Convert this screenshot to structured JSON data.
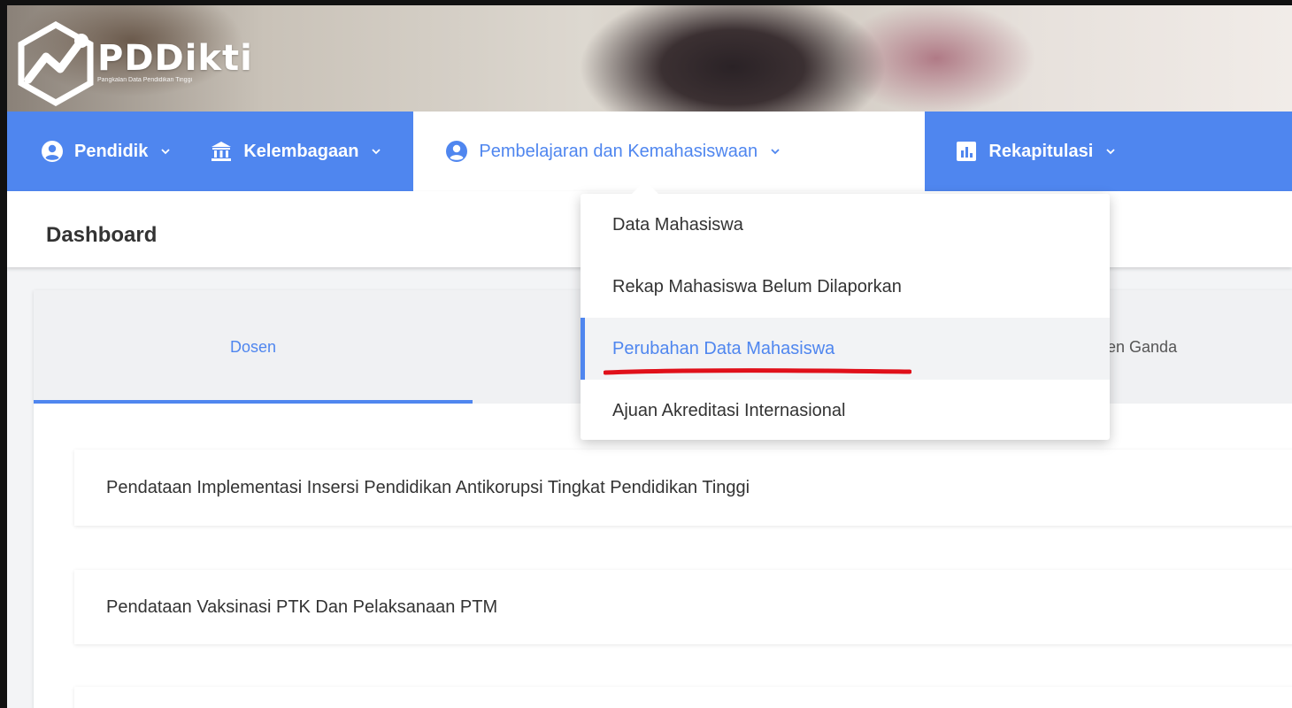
{
  "brand": {
    "name": "PDDikti",
    "tagline": "Pangkalan Data Pendidikan Tinggi"
  },
  "colors": {
    "primary": "#4f86ef",
    "annotation": "#e0101a"
  },
  "nav": {
    "items": [
      {
        "label": "Pendidik",
        "icon": "user-circle-icon"
      },
      {
        "label": "Kelembagaan",
        "icon": "institution-icon"
      },
      {
        "label": "Pembelajaran dan Kemahasiswaan",
        "icon": "user-circle-icon",
        "active": true
      },
      {
        "label": "Rekapitulasi",
        "icon": "bar-chart-icon"
      }
    ]
  },
  "page": {
    "title": "Dashboard"
  },
  "dropdown": {
    "items": [
      {
        "label": "Data Mahasiswa"
      },
      {
        "label": "Rekap Mahasiswa Belum Dilaporkan"
      },
      {
        "label": "Perubahan Data Mahasiswa",
        "highlighted": true
      },
      {
        "label": "Ajuan Akreditasi Internasional"
      }
    ]
  },
  "tabs": [
    {
      "label": "Dosen",
      "active": true
    },
    {
      "label": "osen Ganda"
    }
  ],
  "list": [
    {
      "label": "Pendataan Implementasi Insersi Pendidikan Antikorupsi Tingkat Pendidikan Tinggi"
    },
    {
      "label": "Pendataan Vaksinasi PTK Dan Pelaksanaan PTM"
    }
  ]
}
